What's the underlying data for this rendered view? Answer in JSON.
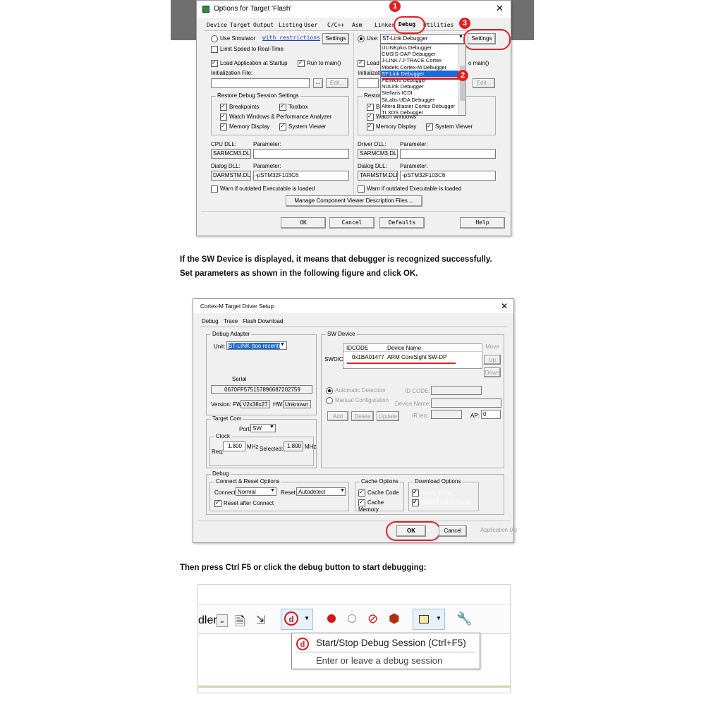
{
  "dialog1": {
    "title": "Options for Target 'Flash'",
    "tabs": [
      "Device",
      "Target",
      "Output",
      "Listing",
      "User",
      "C/C++",
      "Asm",
      "Linker",
      "Debug",
      "Utilities"
    ],
    "use_simulator": "Use Simulator",
    "with_restrictions": "with restrictions",
    "settings": "Settings",
    "limit_speed": "Limit Speed to Real-Time",
    "use_label": "Use:",
    "debugger_selected": "ST-Link Debugger",
    "debugger_options": [
      "ULINKplus Debugger",
      "CMSIS-DAP Debugger",
      "J-LINK / J-TRACE Cortex",
      "Models Cortex-M Debugger",
      "ST-Link Debugger",
      "PEMicro Debugger",
      "NULink Debugger",
      "Stellaris ICDI",
      "SiLabs UDA Debugger",
      "Altera Blaster Cortex Debugger",
      "TI XDS Debugger"
    ],
    "load_app": "Load Application at Startup",
    "run_to_main": "Run to main()",
    "run_to_main_partial": "o main()",
    "load_partial": "Load",
    "init_file": "Initialization File:",
    "init_partial": "Initializatio",
    "browse": "...",
    "edit": "Edit...",
    "restore_group": "Restore Debug Session Settings",
    "restore_partial": "Restore",
    "breakpoints": "Breakpoints",
    "toolbox": "Toolbox",
    "watch_windows": "Watch Windows & Performance Analyzer",
    "watch_windows_short": "Watch Windows",
    "br_partial": "Br",
    "memory_display": "Memory Display",
    "system_viewer": "System Viewer",
    "cpu_dll": "CPU DLL:",
    "driver_dll": "Driver DLL:",
    "parameter": "Parameter:",
    "cpu_dll_val": "SARMCM3.DLL",
    "driver_dll_val": "SARMCM3.DLL",
    "dialog_dll": "Dialog DLL:",
    "dialog_dll_left": "DARMSTM.DLL",
    "dialog_dll_right": "TARMSTM.DLL",
    "dialog_param": "-pSTM32F103C6",
    "warn_outdated": "Warn if outdated Executable is loaded",
    "manage_component": "Manage Component Viewer Description Files ...",
    "ok": "OK",
    "cancel": "Cancel",
    "defaults": "Defaults",
    "help": "Help",
    "badge1": "1",
    "badge2": "2",
    "badge3": "3"
  },
  "text1": "If the SW Device is displayed, it means that debugger is recognized successfully.",
  "text2": "Set parameters as shown in the following figure and click OK.",
  "dialog2": {
    "title": "Cortex-M Target Driver Setup",
    "tabs": [
      "Debug",
      "Trace",
      "Flash Download"
    ],
    "debug_adapter": "Debug Adapter",
    "unit_label": "Unit:",
    "unit_value": "ST-LINK (too recent)",
    "serial_label": "Serial",
    "serial_value": "0670FF575157896687202759",
    "version_label": "Version: FW:",
    "fw_value": "V2x38x27",
    "hw_label": "HW:",
    "hw_value": "Unknown",
    "target_com": "Target Com",
    "port_label": "Port:",
    "port_value": "SW",
    "clock": "Clock",
    "req_label": "Req:",
    "req_value": "1.800",
    "mhz": "MHz",
    "selected_label": "Selected:",
    "selected_value": "1.800",
    "sw_device": "SW Device",
    "idcode_header": "IDCODE",
    "device_name_header": "Device Name",
    "swdio": "SWDIO",
    "idcode_value": "0x1BA01477",
    "device_name_value": "ARM CoreSight SW-DP",
    "move": "Move",
    "up": "Up",
    "down": "Down",
    "auto_detect": "Automatic Detection",
    "manual_config": "Manual Configuration",
    "id_code": "ID CODE:",
    "device_name": "Device Name:",
    "ir_len": "IR len:",
    "ap": "AP:",
    "ap_value": "0",
    "add": "Add",
    "delete": "Delete",
    "update": "Update",
    "debug_group": "Debug",
    "connect_reset": "Connect & Reset Options",
    "connect_label": "Connect:",
    "connect_value": "Normal",
    "reset_label": "Reset:",
    "reset_value": "Autodetect",
    "reset_after_connect": "Reset after Connect",
    "cache_options": "Cache Options",
    "cache_code": "Cache Code",
    "cache_memory": "Cache Memory",
    "download_options": "Download Options",
    "verify_code": "Verify Code Download",
    "download_flash": "Download to Flash",
    "ok": "OK",
    "cancel": "Cancel",
    "apply": "Application (A)"
  },
  "text3": "Then press Ctrl F5 or click the debug button to start debugging:",
  "toolbar": {
    "partial_text": "dler",
    "tooltip_title": "Start/Stop Debug Session (Ctrl+F5)",
    "tooltip_desc": "Enter or leave a debug session"
  }
}
